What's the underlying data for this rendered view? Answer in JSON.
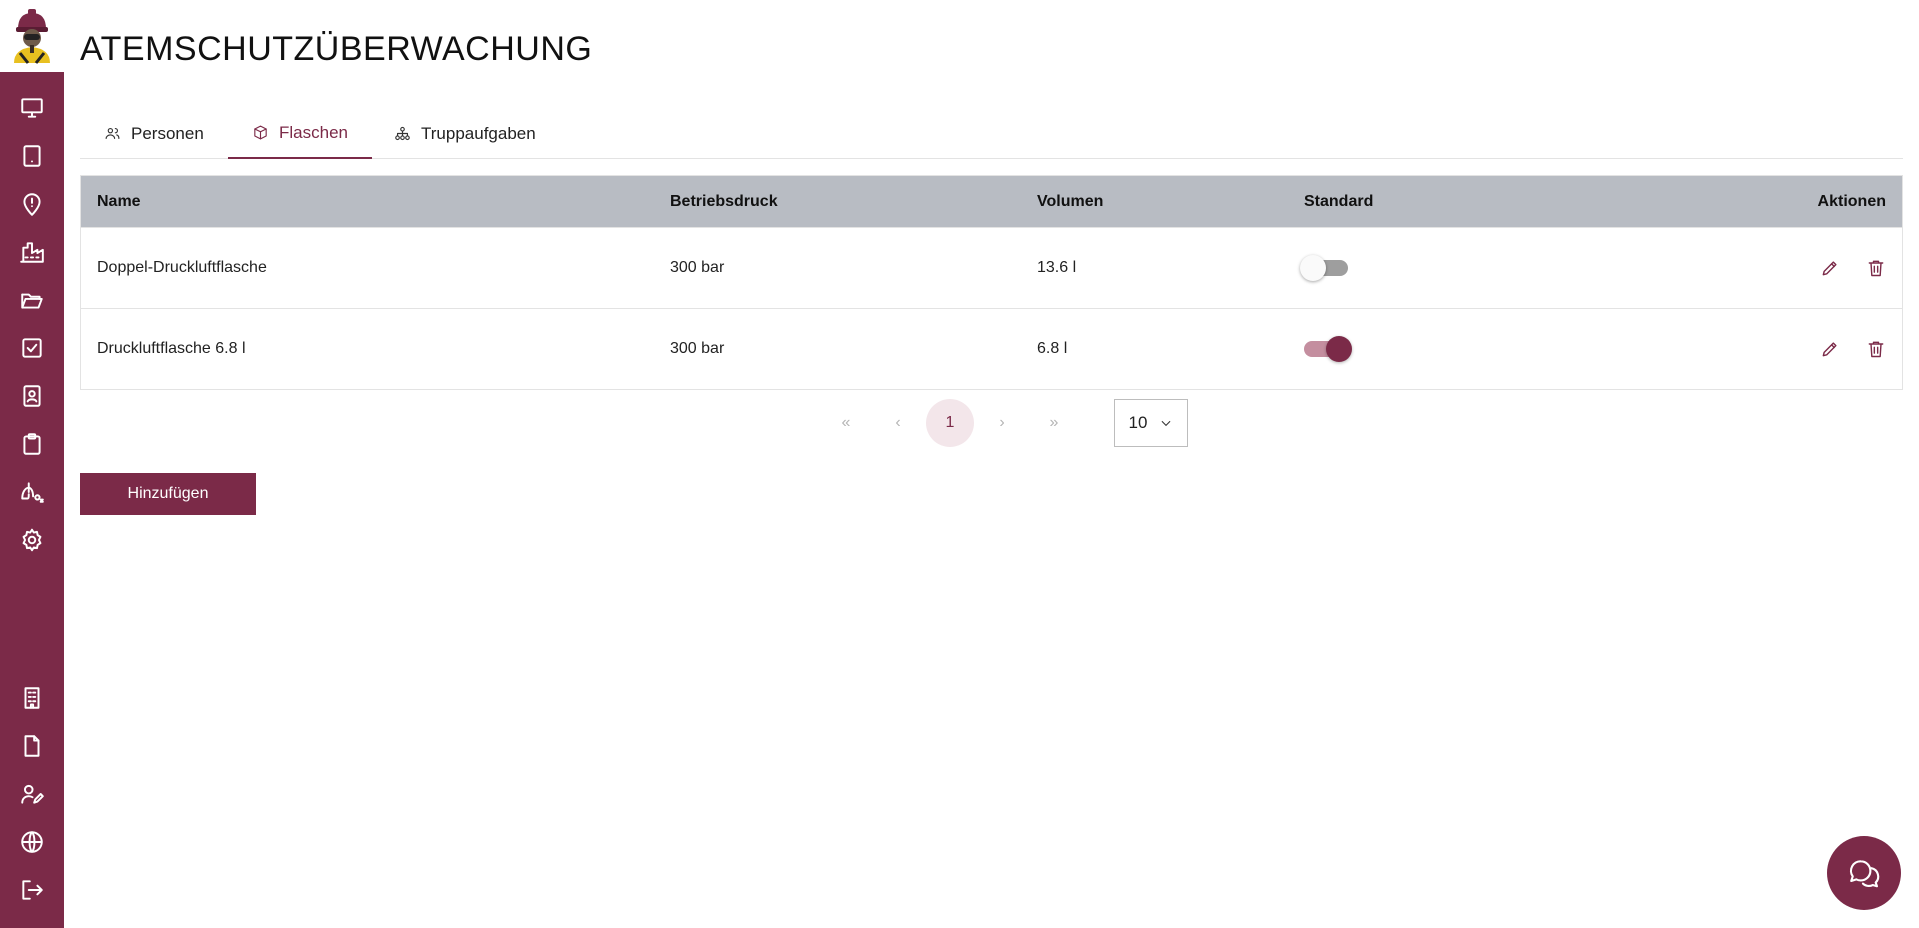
{
  "app": {
    "title": "ATEMSCHUTZÜBERWACHUNG",
    "logo_icon": "firefighter-avatar-icon"
  },
  "sidebar": {
    "top_items": [
      {
        "icon": "monitor-icon"
      },
      {
        "icon": "tablet-icon"
      },
      {
        "icon": "alert-pin-icon"
      },
      {
        "icon": "factory-icon"
      },
      {
        "icon": "folder-open-icon"
      },
      {
        "icon": "checkbox-icon"
      },
      {
        "icon": "contact-icon"
      },
      {
        "icon": "clipboard-icon"
      },
      {
        "icon": "lungs-o2-icon"
      },
      {
        "icon": "gear-icon"
      }
    ],
    "bottom_items": [
      {
        "icon": "building-icon"
      },
      {
        "icon": "document-icon"
      },
      {
        "icon": "user-edit-icon"
      },
      {
        "icon": "globe-icon"
      },
      {
        "icon": "logout-icon"
      }
    ]
  },
  "tabs": [
    {
      "label": "Personen",
      "icon": "people-icon",
      "active": false
    },
    {
      "label": "Flaschen",
      "icon": "box-icon",
      "active": true
    },
    {
      "label": "Truppaufgaben",
      "icon": "hierarchy-icon",
      "active": false
    }
  ],
  "table": {
    "columns": {
      "name": "Name",
      "druck": "Betriebsdruck",
      "volumen": "Volumen",
      "standard": "Standard",
      "aktionen": "Aktionen"
    },
    "rows": [
      {
        "name": "Doppel-Druckluftflasche",
        "druck": "300 bar",
        "volumen": "13.6 l",
        "standard": false
      },
      {
        "name": "Druckluftflasche 6.8 l",
        "druck": "300 bar",
        "volumen": "6.8 l",
        "standard": true
      }
    ]
  },
  "pagination": {
    "first": "«",
    "prev": "‹",
    "current_page": "1",
    "next": "›",
    "last": "»",
    "page_size": "10"
  },
  "add_button": {
    "label": "Hinzufügen"
  },
  "colors": {
    "brand": "#7b2a48",
    "table_header": "#b8bcc3",
    "toggle_on_track": "#c48e9f",
    "toggle_off_track": "#9e9e9e"
  },
  "chat_fab": {
    "icon": "chat-icon"
  }
}
